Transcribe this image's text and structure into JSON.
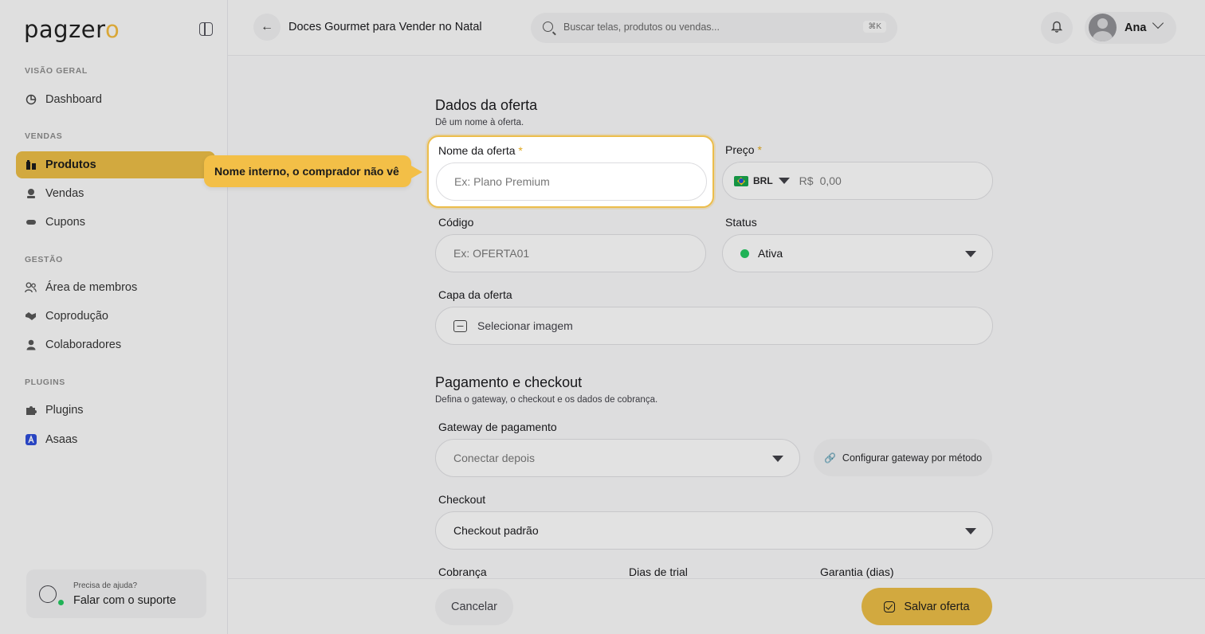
{
  "brand": {
    "logo_main": "pagzer",
    "logo_accent": "o"
  },
  "sidebar": {
    "sections": [
      {
        "label": "VISÃO GERAL",
        "items": [
          {
            "label": "Dashboard",
            "icon": "dashboard-icon"
          }
        ]
      },
      {
        "label": "VENDAS",
        "items": [
          {
            "label": "Produtos",
            "icon": "products-icon",
            "active": true
          },
          {
            "label": "Vendas",
            "icon": "sales-icon"
          },
          {
            "label": "Cupons",
            "icon": "coupon-icon"
          }
        ]
      },
      {
        "label": "GESTÃO",
        "items": [
          {
            "label": "Área de membros",
            "icon": "members-icon"
          },
          {
            "label": "Coprodução",
            "icon": "handshake-icon"
          },
          {
            "label": "Colaboradores",
            "icon": "user-icon"
          }
        ]
      },
      {
        "label": "PLUGINS",
        "items": [
          {
            "label": "Plugins",
            "icon": "puzzle-icon"
          },
          {
            "label": "Asaas",
            "icon": "asaas-icon"
          }
        ]
      }
    ],
    "help": {
      "small": "Precisa de ajuda?",
      "big": "Falar com o suporte"
    }
  },
  "topbar": {
    "title": "Doces Gourmet para Vender no Natal",
    "search_placeholder": "Buscar telas, produtos ou vendas...",
    "search_shortcut": "⌘K",
    "user_name": "Ana"
  },
  "offer": {
    "heading": "Dados da oferta",
    "subheading": "Dê um nome à oferta.",
    "name_label": "Nome da oferta",
    "name_placeholder": "Ex: Plano Premium",
    "price_label": "Preço",
    "currency": "BRL",
    "currency_symbol": "R$",
    "price_placeholder": "0,00",
    "code_label": "Código",
    "code_placeholder": "Ex: OFERTA01",
    "status_label": "Status",
    "status_value": "Ativa",
    "cover_label": "Capa da oferta",
    "cover_button": "Selecionar imagem",
    "required_mark": "*"
  },
  "payment": {
    "heading": "Pagamento e checkout",
    "subheading": "Defina o gateway, o checkout e os dados de cobrança.",
    "gateway_label": "Gateway de pagamento",
    "gateway_value": "Conectar depois",
    "gateway_config_button": "Configurar gateway por método",
    "checkout_label": "Checkout",
    "checkout_value": "Checkout padrão",
    "billing_label": "Cobrança",
    "trial_label": "Dias de trial",
    "warranty_label": "Garantia (dias)"
  },
  "footer": {
    "cancel": "Cancelar",
    "save": "Salvar oferta"
  },
  "tooltip": {
    "text": "Nome interno, o comprador não vê"
  },
  "colors": {
    "accent": "#e8ba44",
    "status_active": "#22c55e"
  }
}
